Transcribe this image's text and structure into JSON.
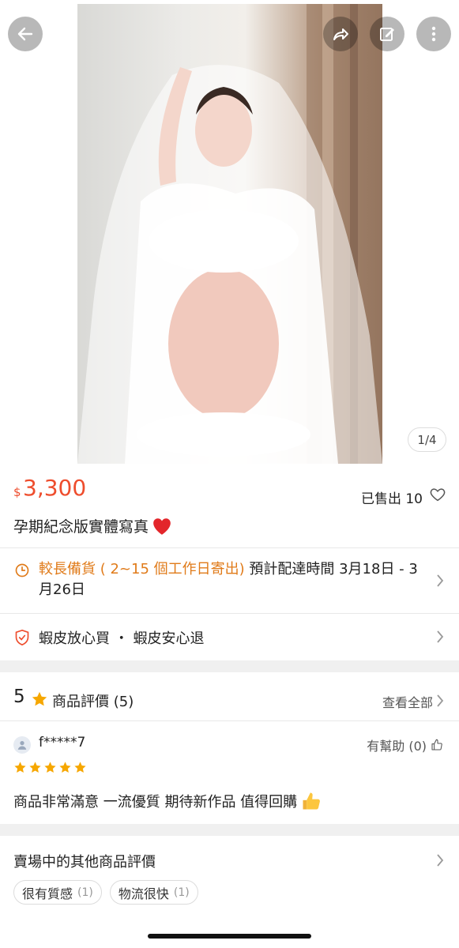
{
  "gallery": {
    "counter": "1/4"
  },
  "product": {
    "currency": "$",
    "price": "3,300",
    "sold_label": "已售出 10",
    "title": "孕期紀念版實體寫真"
  },
  "shipping": {
    "warning": "較長備貨 ( 2~15 個工作日寄出)",
    "estimate": " 預計配達時間 3月18日 - 3月26日"
  },
  "guarantee": {
    "text": "蝦皮放心買 ・ 蝦皮安心退"
  },
  "ratings": {
    "score": "5",
    "label": "商品評價 (5)",
    "see_all": "查看全部"
  },
  "review": {
    "username": "f*****7",
    "helpful": "有幫助 (0)",
    "stars": 5,
    "text": "商品非常滿意 一流優質 期待新作品 值得回購"
  },
  "other_reviews": {
    "title": "賣場中的其他商品評價",
    "tags": [
      {
        "label": "很有質感",
        "count": "(1)"
      },
      {
        "label": "物流很快",
        "count": "(1)"
      }
    ]
  },
  "colors": {
    "accent": "#ee4d2d",
    "warning": "#e07b1a",
    "star": "#f6a700"
  }
}
